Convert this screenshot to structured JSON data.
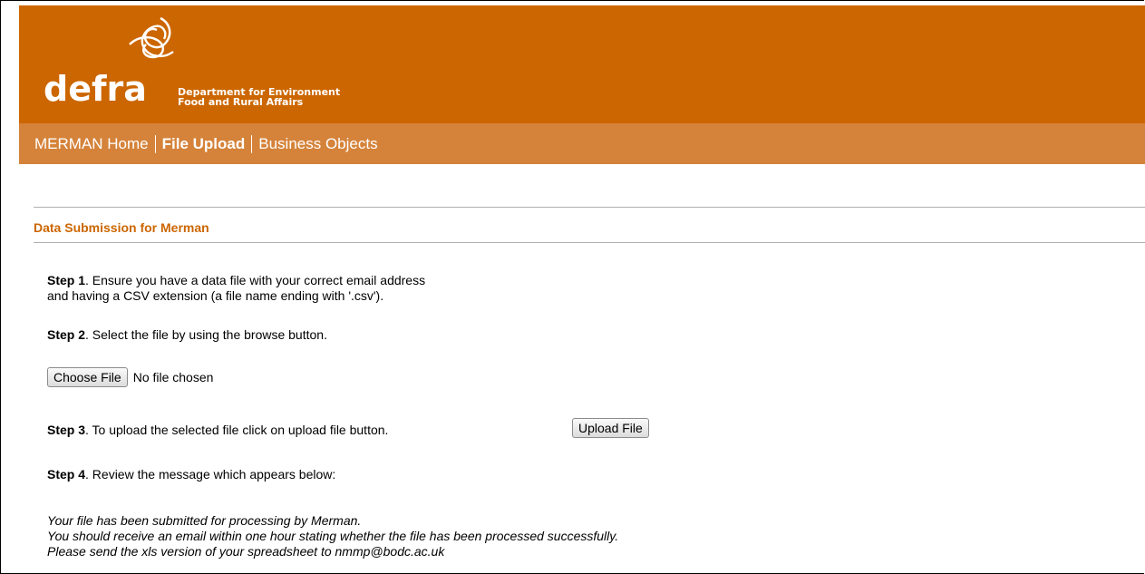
{
  "brand": {
    "wordmark": "defra",
    "subtitle_line1": "Department for Environment",
    "subtitle_line2": "Food and Rural Affairs",
    "colors": {
      "header": "#cc6600",
      "nav": "#d5833a",
      "accent": "#cc6600"
    }
  },
  "nav": {
    "items": [
      {
        "label": "MERMAN Home",
        "active": false
      },
      {
        "label": "File Upload",
        "active": true
      },
      {
        "label": "Business Objects",
        "active": false
      }
    ]
  },
  "main": {
    "title": "Data Submission for Merman",
    "step1": {
      "label": "Step 1",
      "line1": ". Ensure you have a data file with your correct email address",
      "line2": "and having a CSV extension (a file name ending with '.csv')."
    },
    "step2": {
      "label": "Step 2",
      "text": ". Select the file by using the browse button."
    },
    "file_input": {
      "button_label": "Choose File",
      "status": "No file chosen"
    },
    "step3": {
      "label": "Step 3",
      "text": ". To upload the selected file click on upload file button.",
      "button_label": "Upload File"
    },
    "step4": {
      "label": "Step 4",
      "text": ". Review the message which appears below:"
    },
    "message": {
      "line1": "Your file has been submitted for processing by Merman.",
      "line2": "You should receive an email within one hour stating whether the file has been processed successfully.",
      "line3": "Please send the xls version of your spreadsheet to nmmp@bodc.ac.uk"
    }
  }
}
